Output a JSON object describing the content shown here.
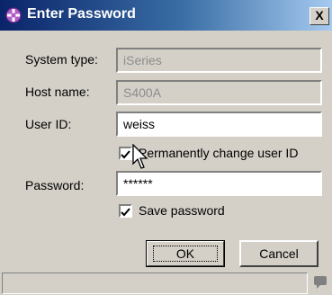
{
  "window": {
    "title": "Enter Password",
    "close_glyph": "X",
    "icon": "eclipse-icon"
  },
  "form": {
    "system_type": {
      "label": "System type:",
      "value": "iSeries",
      "enabled": false
    },
    "host_name": {
      "label": "Host name:",
      "value": "S400A",
      "enabled": false
    },
    "user_id": {
      "label": "User ID:",
      "value": "weiss",
      "enabled": true
    },
    "permanently_change": {
      "label": "Permanently change user ID",
      "checked": true
    },
    "password": {
      "label": "Password:",
      "value": "******",
      "enabled": true
    },
    "save_password": {
      "label": "Save password",
      "checked": true
    }
  },
  "buttons": {
    "ok": "OK",
    "cancel": "Cancel"
  },
  "statusbar": {
    "text": "",
    "icon": "message-icon"
  }
}
